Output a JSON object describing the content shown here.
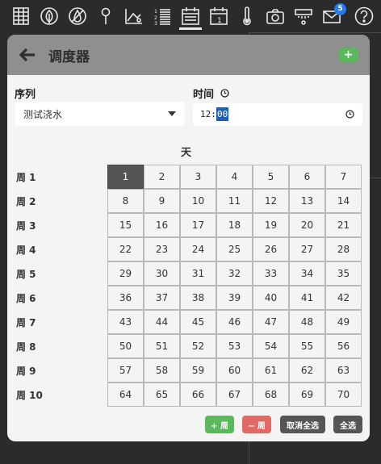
{
  "topbar": {
    "icons": [
      "grid-icon",
      "leaf-icon",
      "no-water-icon",
      "pin-icon",
      "chart-icon",
      "list-icon",
      "calendar-icon",
      "calendar-day-icon",
      "thermometer-icon",
      "camera-icon",
      "sprinkler-icon",
      "mail-icon",
      "help-icon"
    ],
    "calendar_day_number": "1",
    "mail_badge": "5"
  },
  "header": {
    "title": "调度器",
    "add_label": "+"
  },
  "form": {
    "sequence_label": "序列",
    "sequence_value": "测试浇水",
    "time_label": "时间",
    "time_hours": "12:",
    "time_minutes": "00"
  },
  "schedule": {
    "day_header": "天",
    "week_labels": [
      "周 1",
      "周 2",
      "周 3",
      "周 4",
      "周 5",
      "周 6",
      "周 7",
      "周 8",
      "周 9",
      "周 10"
    ],
    "days": [
      [
        "1",
        "2",
        "3",
        "4",
        "5",
        "6",
        "7"
      ],
      [
        "8",
        "9",
        "10",
        "11",
        "12",
        "13",
        "14"
      ],
      [
        "15",
        "16",
        "17",
        "18",
        "19",
        "20",
        "21"
      ],
      [
        "22",
        "23",
        "24",
        "25",
        "26",
        "27",
        "28"
      ],
      [
        "29",
        "30",
        "31",
        "32",
        "33",
        "34",
        "35"
      ],
      [
        "36",
        "37",
        "38",
        "39",
        "40",
        "41",
        "42"
      ],
      [
        "43",
        "44",
        "45",
        "46",
        "47",
        "48",
        "49"
      ],
      [
        "50",
        "51",
        "52",
        "53",
        "54",
        "55",
        "56"
      ],
      [
        "57",
        "58",
        "59",
        "60",
        "61",
        "62",
        "63"
      ],
      [
        "64",
        "65",
        "66",
        "67",
        "68",
        "69",
        "70"
      ]
    ],
    "selected_day": "1"
  },
  "actions": {
    "add_week": "+ 周",
    "remove_week": "− 周",
    "deselect_all": "取消全选",
    "select_all": "全选"
  },
  "colors": {
    "background": "#2b2b2b",
    "card": "#f4f4f4",
    "header": "#8f8f8f",
    "green": "#5cb85c",
    "red": "#d9534f",
    "dark_button": "#555555",
    "selected_cell": "#555555",
    "badge": "#2a7be8"
  }
}
